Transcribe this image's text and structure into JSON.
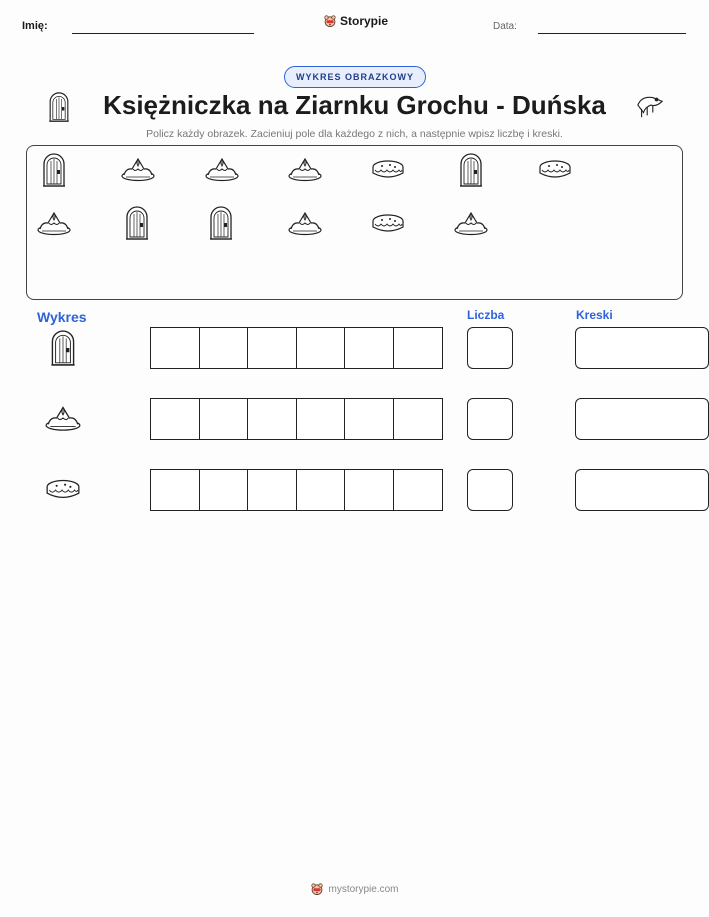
{
  "header": {
    "name_label": "Imię:",
    "date_label": "Data:",
    "brand": "Storypie"
  },
  "badge": "WYKRES OBRAZKOWY",
  "title": "Księżniczka na Ziarnku Grochu - Duńska",
  "instructions": "Policz każdy obrazek. Zacieniuj pole dla każdego z nich, a następnie wpisz liczbę i kreski.",
  "count_items": {
    "row1": [
      "door-icon",
      "crown-icon",
      "crown-icon",
      "crown-icon",
      "pie-icon",
      "door-icon",
      "pie-icon"
    ],
    "row2": [
      "crown-icon",
      "door-icon",
      "door-icon",
      "crown-icon",
      "pie-icon",
      "crown-icon"
    ]
  },
  "chart": {
    "heading": "Wykres",
    "count_heading": "Liczba",
    "tally_heading": "Kreski",
    "rows": [
      {
        "icon": "door-icon",
        "cells": 6
      },
      {
        "icon": "crown-icon",
        "cells": 6
      },
      {
        "icon": "pie-icon",
        "cells": 6
      }
    ]
  },
  "footer": "mystorypie.com"
}
